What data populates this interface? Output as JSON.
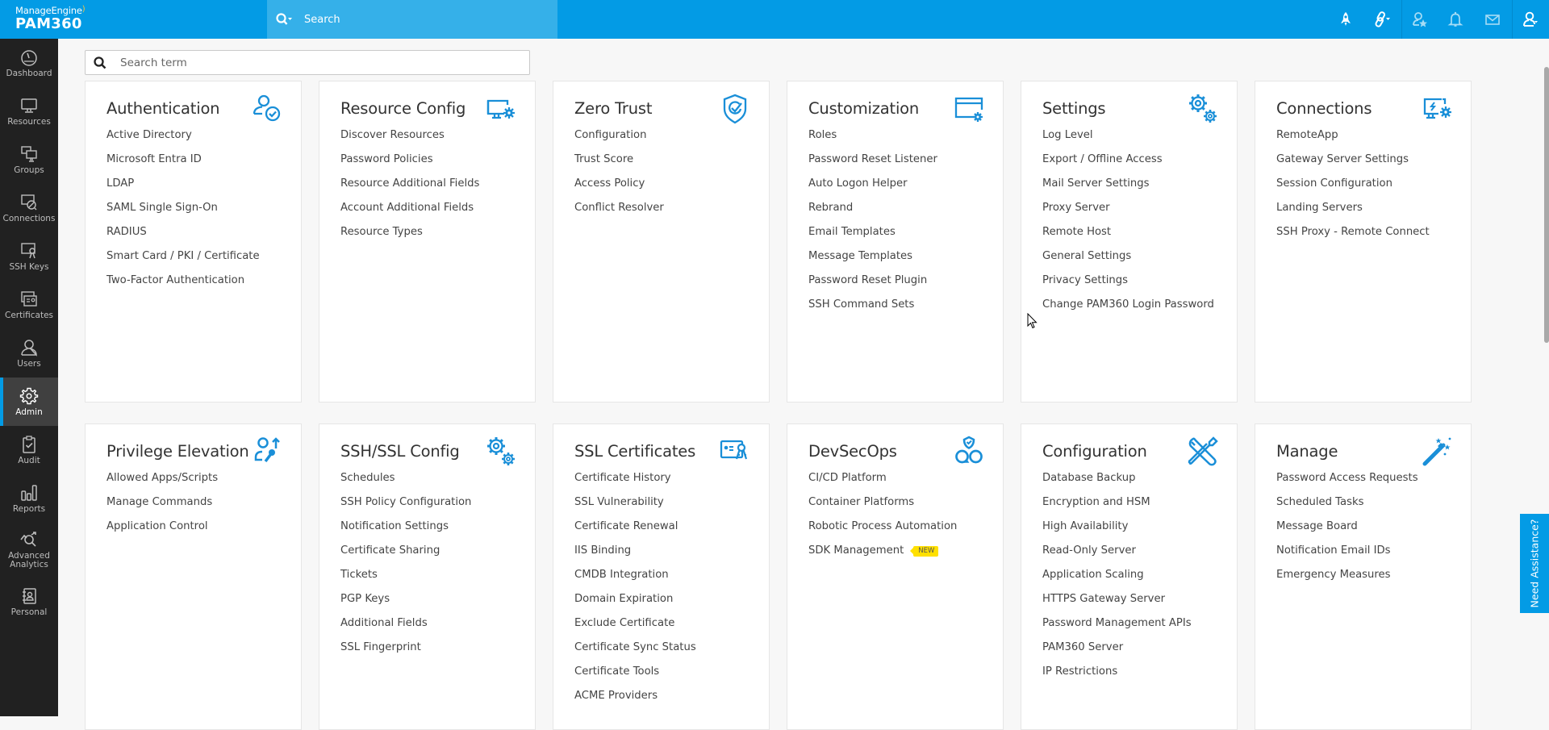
{
  "header": {
    "brand_top": "ManageEngine",
    "brand_product": "PAM360",
    "search_placeholder": "Search",
    "icons": [
      "rocket-icon",
      "link-icon",
      "user-star-icon",
      "bell-icon",
      "mail-icon",
      "user-profile-icon"
    ],
    "accent_color": "#039be5"
  },
  "sidebar": {
    "items": [
      {
        "label": "Dashboard",
        "icon": "dashboard-icon"
      },
      {
        "label": "Resources",
        "icon": "monitor-icon"
      },
      {
        "label": "Groups",
        "icon": "groups-icon"
      },
      {
        "label": "Connections",
        "icon": "connections-icon"
      },
      {
        "label": "SSH Keys",
        "icon": "ssh-keys-icon"
      },
      {
        "label": "Certificates",
        "icon": "certificate-icon"
      },
      {
        "label": "Users",
        "icon": "user-icon"
      },
      {
        "label": "Admin",
        "icon": "gear-icon",
        "active": true
      },
      {
        "label": "Audit",
        "icon": "clipboard-check-icon"
      },
      {
        "label": "Reports",
        "icon": "bar-chart-icon"
      },
      {
        "label": "Advanced Analytics",
        "icon": "analytics-icon"
      },
      {
        "label": "Personal",
        "icon": "personal-icon"
      }
    ]
  },
  "main": {
    "search_placeholder": "Search term",
    "cards": [
      {
        "title": "Authentication",
        "icon": "user-check-icon",
        "items": [
          "Active Directory",
          "Microsoft Entra ID",
          "LDAP",
          "SAML Single Sign-On",
          "RADIUS",
          "Smart Card / PKI / Certificate",
          "Two-Factor Authentication"
        ]
      },
      {
        "title": "Resource Config",
        "icon": "monitor-gear-icon",
        "items": [
          "Discover Resources",
          "Password Policies",
          "Resource Additional Fields",
          "Account Additional Fields",
          "Resource Types"
        ]
      },
      {
        "title": "Zero Trust",
        "icon": "shield-check-icon",
        "items": [
          "Configuration",
          "Trust Score",
          "Access Policy",
          "Conflict Resolver"
        ]
      },
      {
        "title": "Customization",
        "icon": "window-gear-icon",
        "items": [
          "Roles",
          "Password Reset Listener",
          "Auto Logon Helper",
          "Rebrand",
          "Email Templates",
          "Message Templates",
          "Password Reset Plugin",
          "SSH Command Sets"
        ]
      },
      {
        "title": "Settings",
        "icon": "gears-icon",
        "items": [
          "Log Level",
          "Export / Offline Access",
          "Mail Server Settings",
          "Proxy Server",
          "Remote Host",
          "General Settings",
          "Privacy Settings",
          "Change PAM360 Login Password"
        ]
      },
      {
        "title": "Connections",
        "icon": "remote-monitor-gear-icon",
        "items": [
          "RemoteApp",
          "Gateway Server Settings",
          "Session Configuration",
          "Landing Servers",
          "SSH Proxy - Remote Connect"
        ]
      },
      {
        "title": "Privilege Elevation",
        "icon": "user-key-up-icon",
        "items": [
          "Allowed Apps/Scripts",
          "Manage Commands",
          "Application Control"
        ]
      },
      {
        "title": "SSH/SSL Config",
        "icon": "gears-icon",
        "items": [
          "Schedules",
          "SSH Policy Configuration",
          "Notification Settings",
          "Certificate Sharing",
          "Tickets",
          "PGP Keys",
          "Additional Fields",
          "SSL Fingerprint"
        ]
      },
      {
        "title": "SSL Certificates",
        "icon": "cert-keys-icon",
        "items": [
          "Certificate History",
          "SSL Vulnerability",
          "Certificate Renewal",
          "IIS Binding",
          "CMDB Integration",
          "Domain Expiration",
          "Exclude Certificate",
          "Certificate Sync Status",
          "Certificate Tools",
          "ACME Providers"
        ]
      },
      {
        "title": "DevSecOps",
        "icon": "devsecops-icon",
        "items": [
          "CI/CD Platform",
          "Container Platforms",
          "Robotic Process Automation",
          "SDK Management"
        ],
        "badge": {
          "item_index": 3,
          "label": "NEW"
        }
      },
      {
        "title": "Configuration",
        "icon": "tools-icon",
        "items": [
          "Database Backup",
          "Encryption and HSM",
          "High Availability",
          "Read-Only Server",
          "Application Scaling",
          "HTTPS Gateway Server",
          "Password Management APIs",
          "PAM360 Server",
          "IP Restrictions"
        ]
      },
      {
        "title": "Manage",
        "icon": "magic-wand-icon",
        "items": [
          "Password Access Requests",
          "Scheduled Tasks",
          "Message Board",
          "Notification Email IDs",
          "Emergency Measures"
        ]
      }
    ]
  },
  "assist_label": "Need Assistance?"
}
